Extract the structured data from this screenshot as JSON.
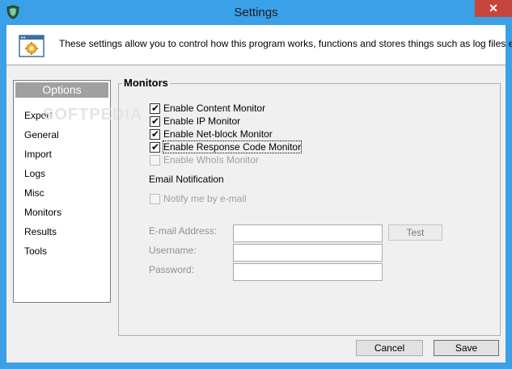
{
  "window": {
    "title": "Settings",
    "close_symbol": "✕"
  },
  "banner": {
    "text": "These settings allow you to control how this program works, functions and stores things such as log files etc."
  },
  "watermark": "SOFTPEDIA",
  "options": {
    "header": "Options",
    "items": [
      {
        "label": "Export"
      },
      {
        "label": "General"
      },
      {
        "label": "Import"
      },
      {
        "label": "Logs"
      },
      {
        "label": "Misc"
      },
      {
        "label": "Monitors"
      },
      {
        "label": "Results"
      },
      {
        "label": "Tools"
      }
    ]
  },
  "monitors": {
    "title": "Monitors",
    "checkboxes": [
      {
        "label": "Enable Content Monitor",
        "checked": true,
        "enabled": true
      },
      {
        "label": "Enable IP Monitor",
        "checked": true,
        "enabled": true
      },
      {
        "label": "Enable Net-block Monitor",
        "checked": true,
        "enabled": true
      },
      {
        "label": "Enable Response Code Monitor",
        "checked": true,
        "enabled": true
      },
      {
        "label": "Enable WhoIs Monitor",
        "checked": false,
        "enabled": false
      }
    ],
    "email_section": "Email Notification",
    "notify": {
      "label": "Notify me by e-mail",
      "checked": false,
      "enabled": false
    },
    "email_label": "E-mail Address:",
    "email_value": "",
    "test_button": "Test",
    "username_label": "Username:",
    "username_value": "",
    "password_label": "Password:",
    "password_value": ""
  },
  "buttons": {
    "cancel": "Cancel",
    "save": "Save"
  },
  "colors": {
    "titlebar": "#3aa0e8",
    "close": "#c7463c",
    "options_header": "#a0a0a0"
  }
}
